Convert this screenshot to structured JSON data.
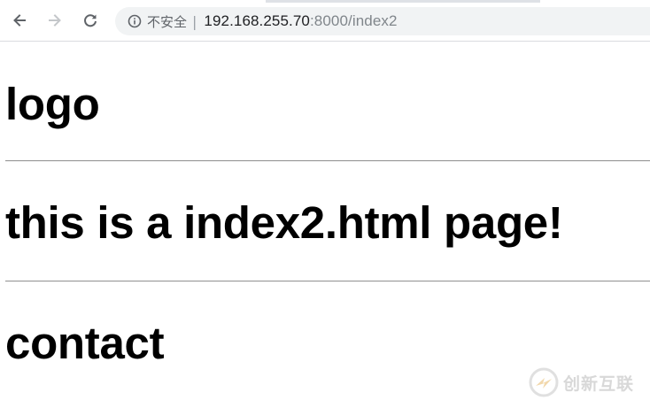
{
  "browser": {
    "security_label": "不安全",
    "separator": "|",
    "url_host": "192.168.255.70",
    "url_rest": ":8000/index2"
  },
  "icons": {
    "back": "arrow-left-icon",
    "forward": "arrow-right-icon",
    "reload": "reload-icon",
    "info": "info-icon"
  },
  "page": {
    "logo_heading": "logo",
    "main_heading": "this is a index2.html page!",
    "contact_heading": "contact"
  },
  "watermark": {
    "text": "创新互联"
  },
  "colors": {
    "omnibox_bg": "#f1f3f4",
    "url_host": "#202124",
    "url_rest": "#80868b",
    "watermark": "#b9b9b9"
  }
}
